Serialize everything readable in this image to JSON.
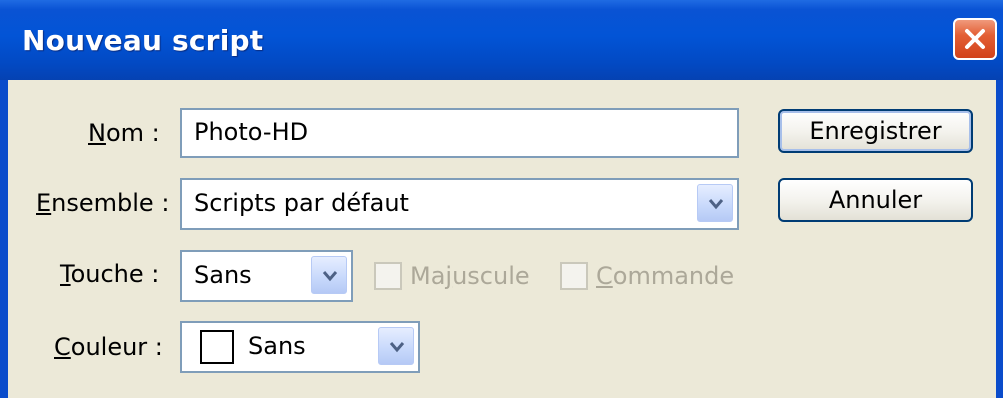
{
  "window": {
    "title": "Nouveau script",
    "close_icon": "close-icon"
  },
  "form": {
    "name": {
      "label_ul": "N",
      "label_rest": "om :",
      "value": "Photo-HD"
    },
    "set": {
      "label_ul": "E",
      "label_rest": "nsemble :",
      "value": "Scripts par défaut",
      "icon": "chevron-down-icon"
    },
    "key": {
      "label_ul": "T",
      "label_rest": "ouche :",
      "value": "Sans",
      "icon": "chevron-down-icon"
    },
    "shift": {
      "label_pre": "Ma",
      "label_ul": "j",
      "label_rest": "uscule",
      "checked": false,
      "enabled": false
    },
    "command": {
      "label_ul": "C",
      "label_rest": "ommande",
      "checked": false,
      "enabled": false
    },
    "color": {
      "label_ul": "C",
      "label_rest": "ouleur :",
      "value": "Sans",
      "swatch_color": "#ffffff",
      "icon": "chevron-down-icon"
    }
  },
  "buttons": {
    "save": "Enregistrer",
    "cancel": "Annuler"
  },
  "colors": {
    "titlebar": "#0254d6",
    "dialog_bg": "#ece9d8",
    "field_border": "#7f9db9",
    "disabled_text": "#aca899",
    "close_button": "#e35f35"
  }
}
